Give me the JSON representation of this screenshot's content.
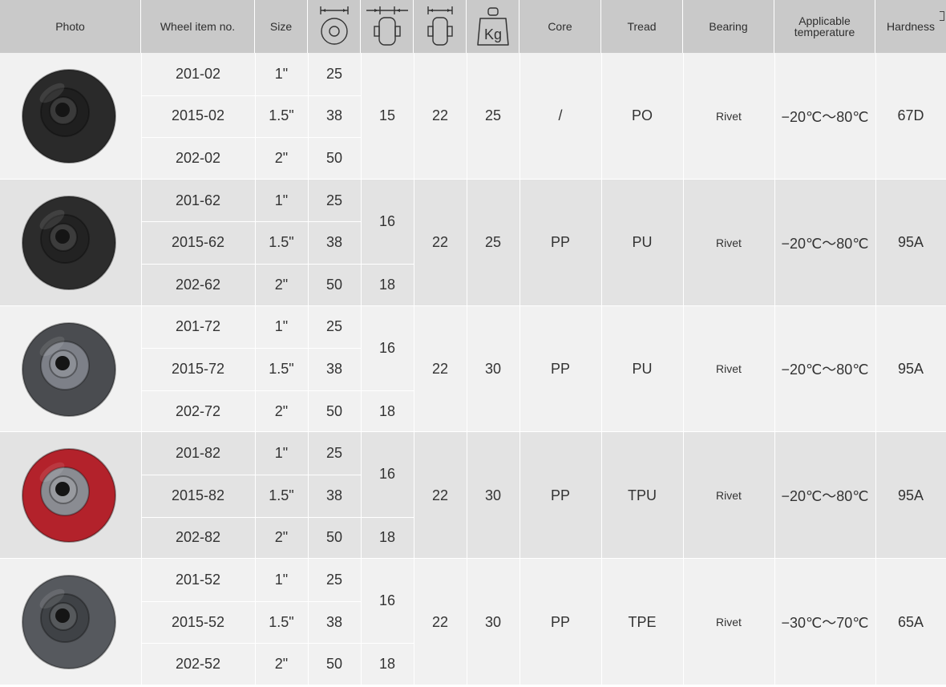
{
  "headers": {
    "photo": "Photo",
    "item": "Wheel item no.",
    "size": "Size",
    "icon_diameter": "wheel-diameter-icon",
    "icon_width": "wheel-width-icon",
    "icon_hub": "hub-length-icon",
    "icon_load": "load-kg-icon",
    "load_unit": "Kg",
    "core": "Core",
    "tread": "Tread",
    "bearing": "Bearing",
    "temperature_line1": "Applicable",
    "temperature_line2": "temperature",
    "hardness": "Hardness"
  },
  "groups": [
    {
      "wheel_color": "#2a2a2a",
      "hub_color": "#1f1f1f",
      "rows": [
        {
          "item": "201-02",
          "size": "1\"",
          "diameter": "25"
        },
        {
          "item": "2015-02",
          "size": "1.5\"",
          "diameter": "38"
        },
        {
          "item": "202-02",
          "size": "2\"",
          "diameter": "50"
        }
      ],
      "width": [
        "15"
      ],
      "hub": "22",
      "load": "25",
      "core": "/",
      "tread": "PO",
      "bearing": "Rivet",
      "temperature": "−20℃～80℃",
      "hardness": "67D"
    },
    {
      "wheel_color": "#2c2c2c",
      "hub_color": "#222222",
      "rows": [
        {
          "item": "201-62",
          "size": "1\"",
          "diameter": "25"
        },
        {
          "item": "2015-62",
          "size": "1.5\"",
          "diameter": "38"
        },
        {
          "item": "202-62",
          "size": "2\"",
          "diameter": "50"
        }
      ],
      "width": [
        "16",
        "18"
      ],
      "hub": "22",
      "load": "25",
      "core": "PP",
      "tread": "PU",
      "bearing": "Rivet",
      "temperature": "−20℃～80℃",
      "hardness": "95A"
    },
    {
      "wheel_color": "#4a4c50",
      "hub_color": "#7d8088",
      "rows": [
        {
          "item": "201-72",
          "size": "1\"",
          "diameter": "25"
        },
        {
          "item": "2015-72",
          "size": "1.5\"",
          "diameter": "38"
        },
        {
          "item": "202-72",
          "size": "2\"",
          "diameter": "50"
        }
      ],
      "width": [
        "16",
        "18"
      ],
      "hub": "22",
      "load": "30",
      "core": "PP",
      "tread": "PU",
      "bearing": "Rivet",
      "temperature": "−20℃～80℃",
      "hardness": "95A"
    },
    {
      "wheel_color": "#b3222b",
      "hub_color": "#8a8c92",
      "rows": [
        {
          "item": "201-82",
          "size": "1\"",
          "diameter": "25"
        },
        {
          "item": "2015-82",
          "size": "1.5\"",
          "diameter": "38"
        },
        {
          "item": "202-82",
          "size": "2\"",
          "diameter": "50"
        }
      ],
      "width": [
        "16",
        "18"
      ],
      "hub": "22",
      "load": "30",
      "core": "PP",
      "tread": "TPU",
      "bearing": "Rivet",
      "temperature": "−20℃～80℃",
      "hardness": "95A"
    },
    {
      "wheel_color": "#56595e",
      "hub_color": "#3f4246",
      "rows": [
        {
          "item": "201-52",
          "size": "1\"",
          "diameter": "25"
        },
        {
          "item": "2015-52",
          "size": "1.5\"",
          "diameter": "38"
        },
        {
          "item": "202-52",
          "size": "2\"",
          "diameter": "50"
        }
      ],
      "width": [
        "16",
        "18"
      ],
      "hub": "22",
      "load": "30",
      "core": "PP",
      "tread": "TPE",
      "bearing": "Rivet",
      "temperature": "−30℃～70℃",
      "hardness": "65A"
    }
  ]
}
